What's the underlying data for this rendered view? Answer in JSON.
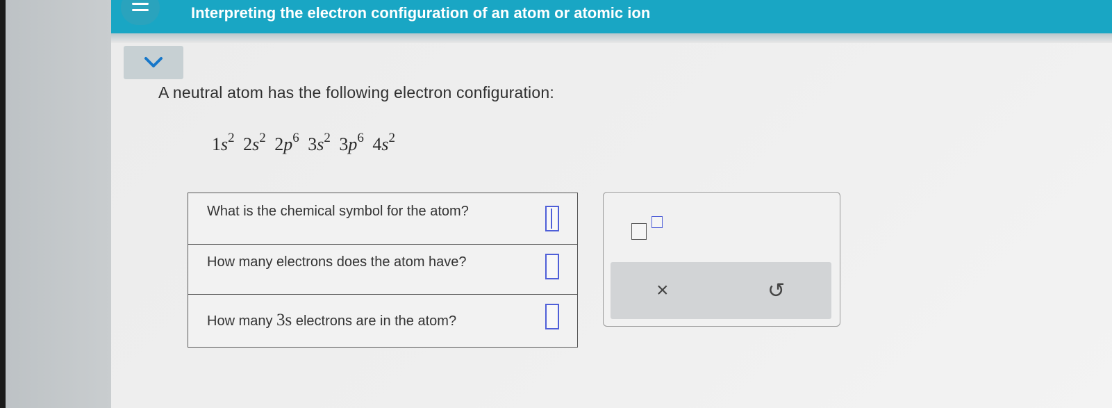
{
  "header": {
    "title": "Interpreting the electron configuration of an atom or atomic ion"
  },
  "problem": {
    "prompt": "A neutral atom has the following electron configuration:",
    "configuration": [
      {
        "n": "1",
        "l": "s",
        "e": "2"
      },
      {
        "n": "2",
        "l": "s",
        "e": "2"
      },
      {
        "n": "2",
        "l": "p",
        "e": "6"
      },
      {
        "n": "3",
        "l": "s",
        "e": "2"
      },
      {
        "n": "3",
        "l": "p",
        "e": "6"
      },
      {
        "n": "4",
        "l": "s",
        "e": "2"
      }
    ]
  },
  "questions": [
    {
      "text": "What is the chemical symbol for the atom?",
      "answer": ""
    },
    {
      "text": "How many electrons does the atom have?",
      "answer": ""
    },
    {
      "text_prefix": "How many ",
      "text_symbol": "3s",
      "text_suffix": " electrons are in the atom?",
      "answer": ""
    }
  ],
  "tools": {
    "superscript": "superscript-tool",
    "clear": "×",
    "undo": "↺"
  },
  "colors": {
    "header": "#19a6c4",
    "input_border": "#4f5fd8"
  }
}
